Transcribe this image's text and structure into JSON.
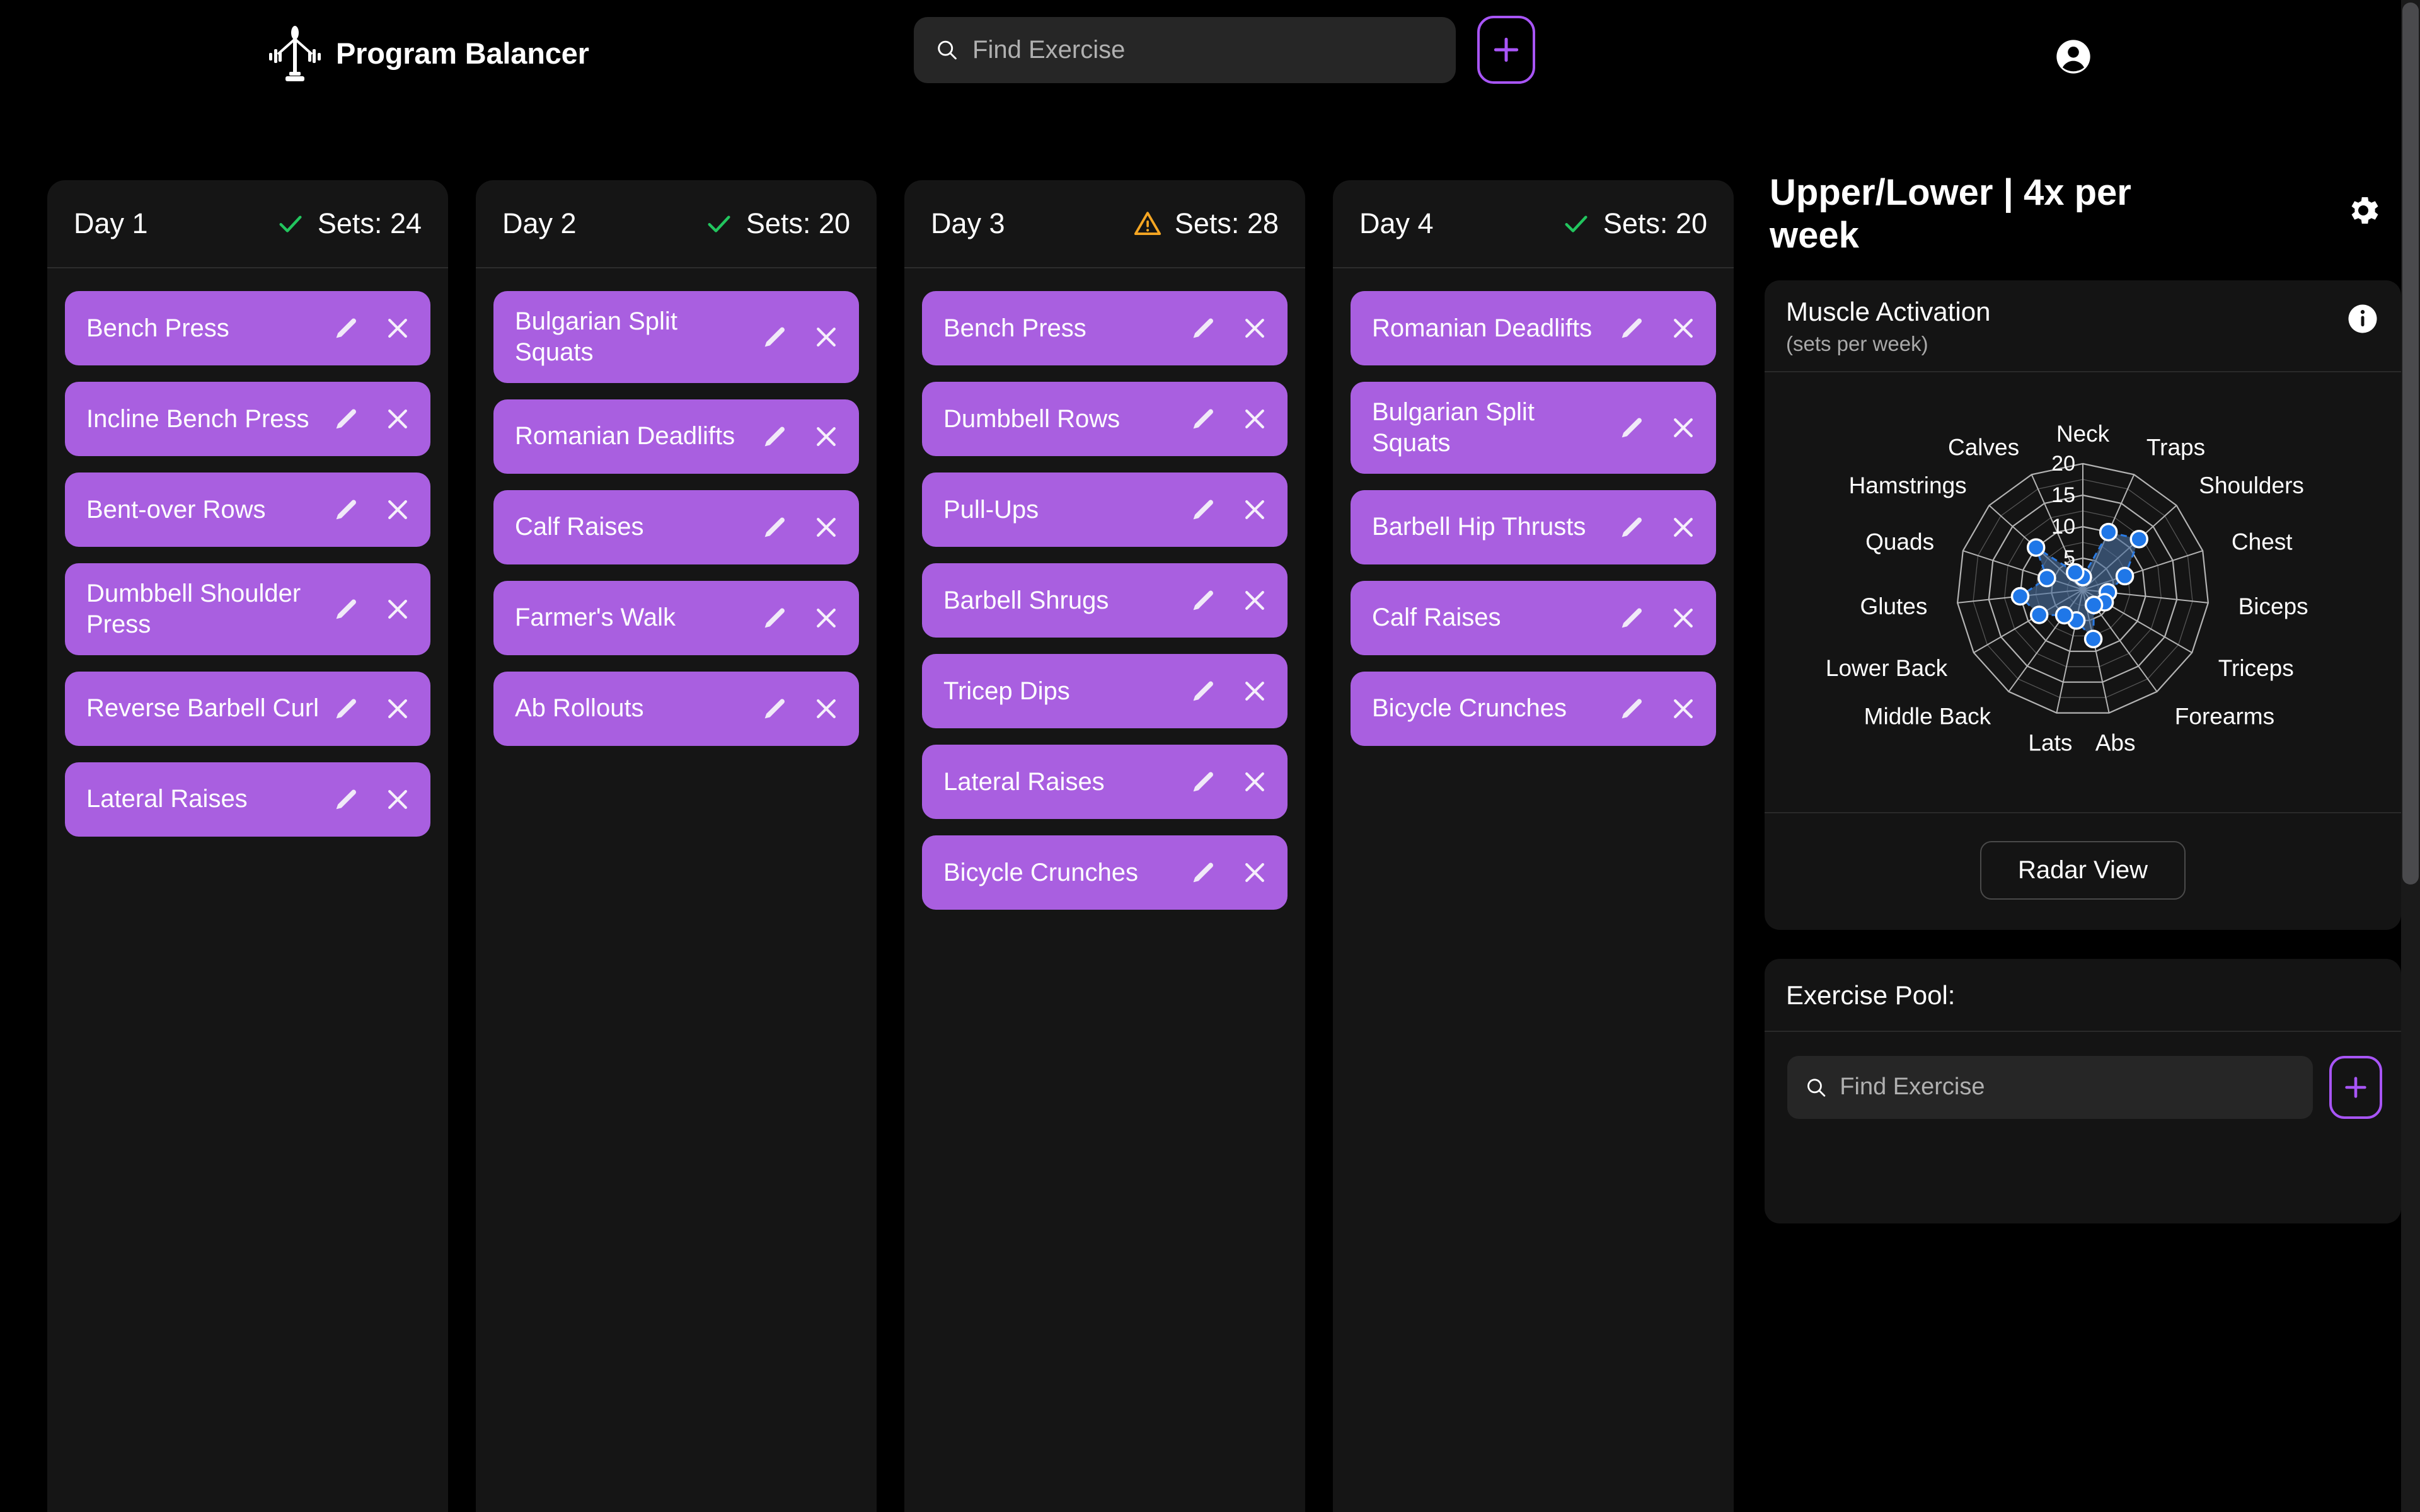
{
  "app": {
    "brand_name": "Program Balancer",
    "logo_icon": "balance-scale-dumbbell-icon",
    "account_icon": "account-circle-icon"
  },
  "header_search": {
    "placeholder": "Find Exercise",
    "value": "",
    "search_icon": "search-icon",
    "add_label": "+",
    "add_icon": "plus-icon"
  },
  "days": [
    {
      "title": "Day 1",
      "sets_label": "Sets: 24",
      "status": "ok",
      "status_icon": "check-icon",
      "status_color": "#22c55e",
      "exercises": [
        {
          "name": "Bench Press"
        },
        {
          "name": "Incline Bench Press"
        },
        {
          "name": "Bent-over Rows"
        },
        {
          "name": "Dumbbell Shoulder Press"
        },
        {
          "name": "Reverse Barbell Curl"
        },
        {
          "name": "Lateral Raises"
        }
      ]
    },
    {
      "title": "Day 2",
      "sets_label": "Sets: 20",
      "status": "ok",
      "status_icon": "check-icon",
      "status_color": "#22c55e",
      "exercises": [
        {
          "name": "Bulgarian Split Squats"
        },
        {
          "name": "Romanian Deadlifts"
        },
        {
          "name": "Calf Raises"
        },
        {
          "name": "Farmer's Walk"
        },
        {
          "name": "Ab Rollouts"
        }
      ]
    },
    {
      "title": "Day 3",
      "sets_label": "Sets: 28",
      "status": "warning",
      "status_icon": "warning-triangle-icon",
      "status_color": "#f5a623",
      "exercises": [
        {
          "name": "Bench Press"
        },
        {
          "name": "Dumbbell Rows"
        },
        {
          "name": "Pull-Ups"
        },
        {
          "name": "Barbell Shrugs"
        },
        {
          "name": "Tricep Dips"
        },
        {
          "name": "Lateral Raises"
        },
        {
          "name": "Bicycle Crunches"
        }
      ]
    },
    {
      "title": "Day 4",
      "sets_label": "Sets: 20",
      "status": "ok",
      "status_icon": "check-icon",
      "status_color": "#22c55e",
      "exercises": [
        {
          "name": "Romanian Deadlifts"
        },
        {
          "name": "Bulgarian Split Squats"
        },
        {
          "name": "Barbell Hip Thrusts"
        },
        {
          "name": "Calf Raises"
        },
        {
          "name": "Bicycle Crunches"
        }
      ]
    }
  ],
  "card_actions": {
    "edit_icon": "pencil-edit-icon",
    "remove_icon": "close-x-icon"
  },
  "right_panel": {
    "program_title": "Upper/Lower | 4x per week",
    "settings_icon": "gear-icon",
    "muscle_card": {
      "title": "Muscle Activation",
      "subtitle": "(sets per week)",
      "info_icon": "info-icon",
      "view_button": "Radar View"
    },
    "pool": {
      "title": "Exercise Pool:",
      "placeholder": "Find Exercise",
      "value": "",
      "search_icon": "search-icon",
      "add_icon": "plus-icon"
    }
  },
  "colors": {
    "accent_purple": "#a855f7",
    "card_purple": "#a95fe0",
    "ok_green": "#22c55e",
    "warn_amber": "#f5a623",
    "radar_point": "#1f77e8",
    "radar_fill": "#4a6f9e",
    "background": "#000000",
    "surface": "#141414"
  },
  "chart_data": {
    "type": "radar",
    "title": "Muscle Activation",
    "subtitle": "(sets per week)",
    "unit": "sets per week",
    "rmin": 0,
    "rmax": 20,
    "rticks": [
      5,
      10,
      15,
      20
    ],
    "grid": true,
    "legend": "none",
    "categories": [
      "Neck",
      "Traps",
      "Shoulders",
      "Chest",
      "Biceps",
      "Triceps",
      "Forearms",
      "Abs",
      "Lats",
      "Middle Back",
      "Lower Back",
      "Glutes",
      "Quads",
      "Hamstrings",
      "Calves"
    ],
    "series": [
      {
        "name": "Sets per week",
        "values": [
          2,
          10,
          12,
          7,
          4,
          4,
          3,
          8,
          5,
          5,
          8,
          10,
          6,
          10,
          3
        ]
      }
    ]
  }
}
